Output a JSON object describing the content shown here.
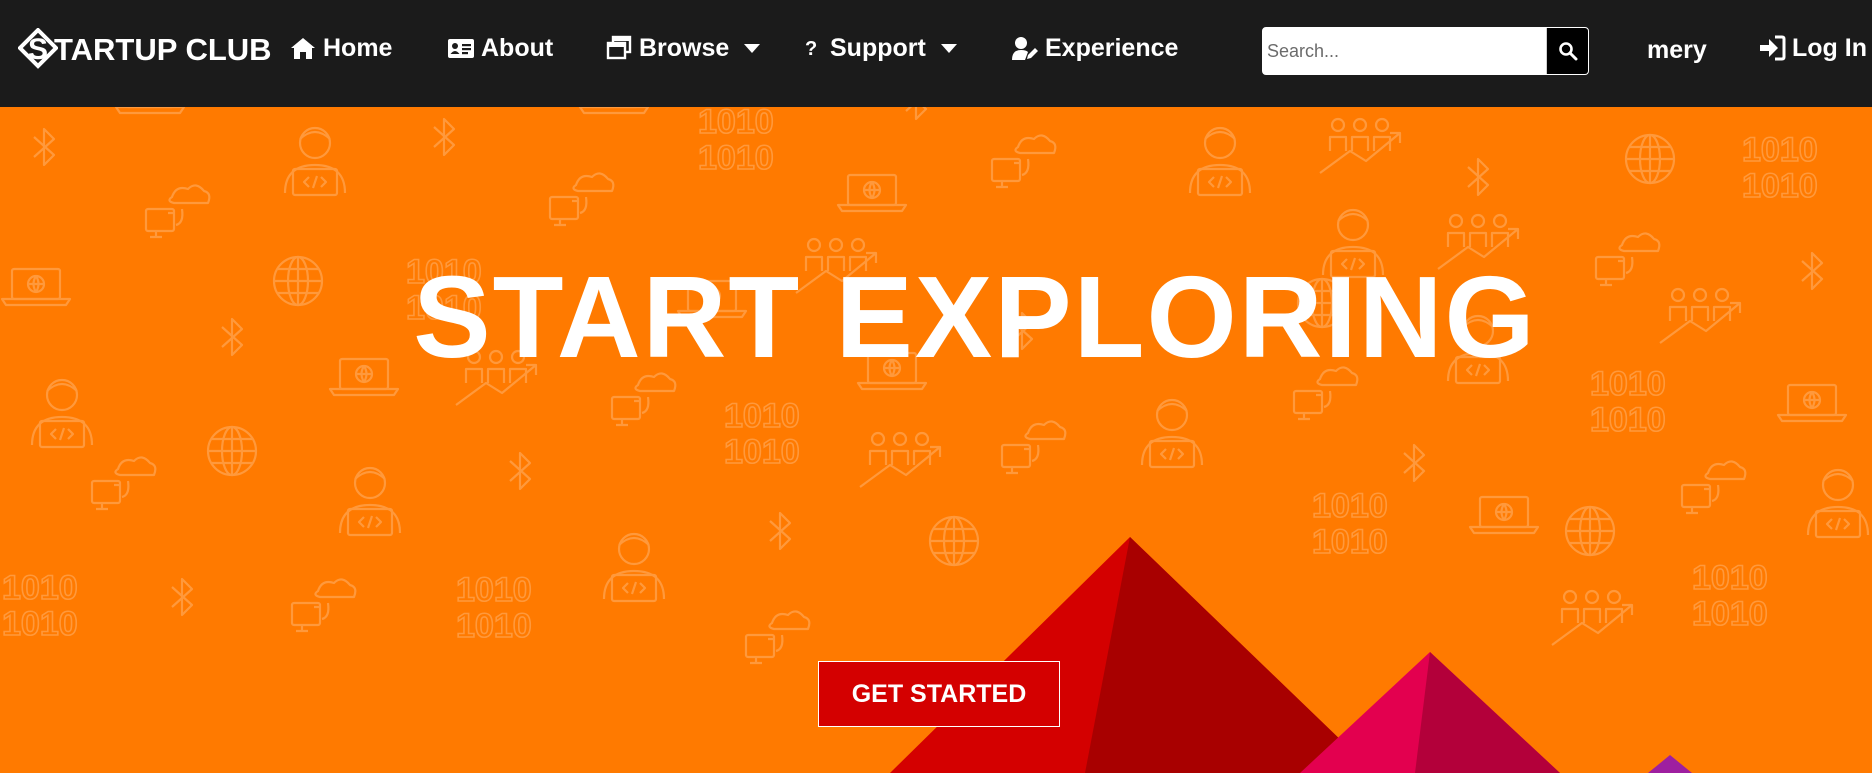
{
  "brand": {
    "name": "TARTUP CLUB",
    "logo_letter": "S",
    "icon": "startup-club-logo-icon"
  },
  "nav": {
    "items": [
      {
        "label": "Home",
        "icon": "home-icon"
      },
      {
        "label": "About",
        "icon": "id-card-icon"
      },
      {
        "label": "Browse",
        "icon": "windows-icon",
        "dropdown": true
      },
      {
        "label": "Support",
        "icon": "question-icon",
        "dropdown": true
      },
      {
        "label": "Experience",
        "icon": "user-edit-icon"
      }
    ]
  },
  "search": {
    "placeholder": "Search...",
    "value": "",
    "button_icon": "search-icon"
  },
  "user": {
    "name": "mery"
  },
  "login": {
    "label": "Log In",
    "icon": "sign-in-icon"
  },
  "hero": {
    "title": "START EXPLORING",
    "cta_label": "GET STARTED",
    "background_color": "#ff7a00",
    "accent_colors": [
      "#d40000",
      "#a80000",
      "#e3004f",
      "#b3003a",
      "#9e1fa0"
    ]
  },
  "colors": {
    "navbar": "#1b1b1b",
    "text": "#ffffff"
  }
}
